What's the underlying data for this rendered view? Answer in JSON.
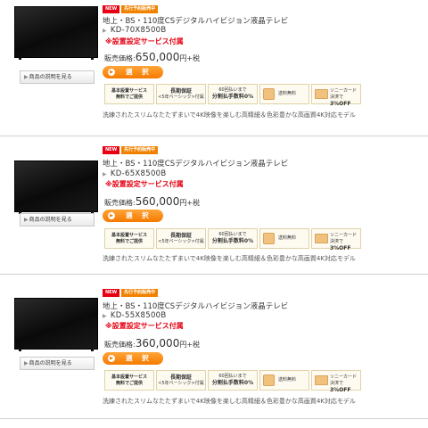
{
  "products": [
    {
      "badges": [
        "NEW",
        "先行予約販売中"
      ],
      "title": "地上・BS・110度CSデジタルハイビジョン液晶テレビ",
      "model": "KD-70X8500B",
      "service": "※設置設定サービス付属",
      "price_label": "販売価格:",
      "price": "650,000",
      "price_suffix": "円+税",
      "select_label": "選 択",
      "desc_button": "商品の説明を見る",
      "services": {
        "install": [
          "基本設置サービス",
          "無料でご提供"
        ],
        "warranty": [
          "長期保証",
          "<5年ベーシック>付属"
        ],
        "installment": [
          "60回払いまで",
          "分割払手数料0%"
        ],
        "shipping": "送料無料",
        "card": [
          "ソニーカード決済で",
          "3%OFF"
        ]
      },
      "catch": "洗練されたスリムなたたずまいで4K映像を楽しむ高精細＆色彩豊かな高画質4K対応モデル"
    },
    {
      "badges": [
        "NEW",
        "先行予約販売中"
      ],
      "title": "地上・BS・110度CSデジタルハイビジョン液晶テレビ",
      "model": "KD-65X8500B",
      "service": "※設置設定サービス付属",
      "price_label": "販売価格:",
      "price": "560,000",
      "price_suffix": "円+税",
      "select_label": "選 択",
      "desc_button": "商品の説明を見る",
      "services": {
        "install": [
          "基本設置サービス",
          "無料でご提供"
        ],
        "warranty": [
          "長期保証",
          "<5年ベーシック>付属"
        ],
        "installment": [
          "60回払いまで",
          "分割払手数料0%"
        ],
        "shipping": "送料無料",
        "card": [
          "ソニーカード決済で",
          "3%OFF"
        ]
      },
      "catch": "洗練されたスリムなたたずまいで4K映像を楽しむ高精細＆色彩豊かな高画質4K対応モデル"
    },
    {
      "badges": [
        "NEW",
        "先行予約販売中"
      ],
      "title": "地上・BS・110度CSデジタルハイビジョン液晶テレビ",
      "model": "KD-55X8500B",
      "service": "※設置設定サービス付属",
      "price_label": "販売価格:",
      "price": "360,000",
      "price_suffix": "円+税",
      "select_label": "選 択",
      "desc_button": "商品の説明を見る",
      "services": {
        "install": [
          "基本設置サービス",
          "無料でご提供"
        ],
        "warranty": [
          "長期保証",
          "<5年ベーシック>付属"
        ],
        "installment": [
          "60回払いまで",
          "分割払手数料0%"
        ],
        "shipping": "送料無料",
        "card": [
          "ソニーカード決済で",
          "3%OFF"
        ]
      },
      "catch": "洗練されたスリムなたたずまいで4K映像を楽しむ高精細＆色彩豊かな高画質4K対応モデル"
    }
  ],
  "colors": {
    "accent_orange": "#f57a00",
    "new_red": "#e60012",
    "separator": "#cfcfcf"
  },
  "icons": [
    "tv-image",
    "arrow-right-icon",
    "gift-icon",
    "card-icon"
  ]
}
